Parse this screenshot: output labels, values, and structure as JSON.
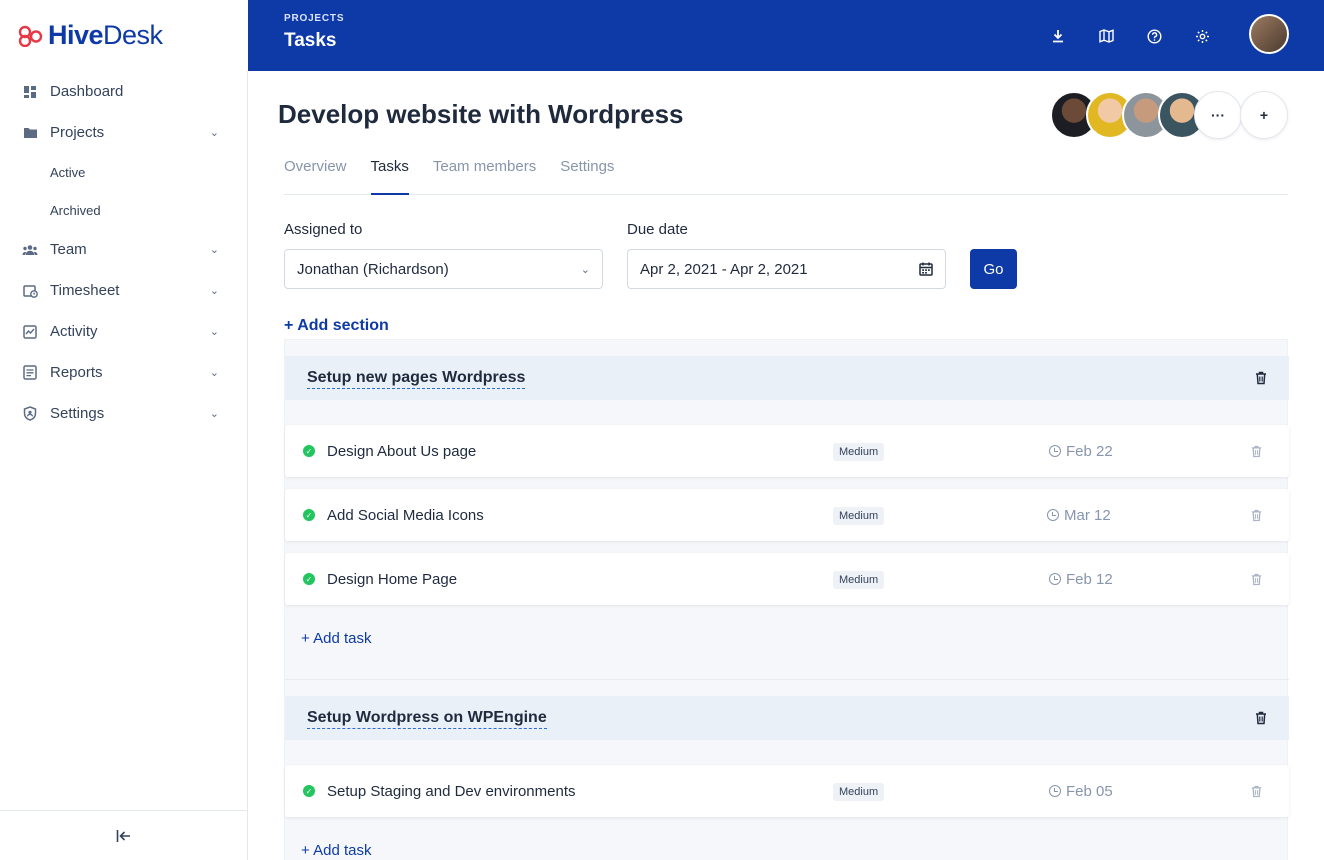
{
  "brand": {
    "name_bold": "Hive",
    "name_light": "Desk"
  },
  "header": {
    "kicker": "PROJECTS",
    "title": "Tasks"
  },
  "sidebar": {
    "items": [
      {
        "label": "Dashboard"
      },
      {
        "label": "Projects"
      },
      {
        "label": "Team"
      },
      {
        "label": "Timesheet"
      },
      {
        "label": "Activity"
      },
      {
        "label": "Reports"
      },
      {
        "label": "Settings"
      }
    ],
    "sub_items": [
      {
        "label": "Active"
      },
      {
        "label": "Archived"
      }
    ]
  },
  "project": {
    "title": "Develop website with Wordpress"
  },
  "members": {
    "more_label": "···",
    "add_label": "+"
  },
  "tabs": [
    {
      "label": "Overview"
    },
    {
      "label": "Tasks"
    },
    {
      "label": "Team members"
    },
    {
      "label": "Settings"
    }
  ],
  "filters": {
    "assigned_label": "Assigned to",
    "assigned_value": "Jonathan (Richardson)",
    "due_label": "Due date",
    "due_value": "Apr 2, 2021 - Apr 2, 2021",
    "go_label": "Go"
  },
  "add_section_label": "+ Add section",
  "sections": [
    {
      "name": "Setup new pages Wordpress",
      "tasks": [
        {
          "name": "Design About Us page",
          "priority": "Medium",
          "due": "Feb 22"
        },
        {
          "name": "Add Social Media Icons",
          "priority": "Medium",
          "due": "Mar 12"
        },
        {
          "name": "Design Home Page",
          "priority": "Medium",
          "due": "Feb 12"
        }
      ],
      "add_task_label": "+ Add task"
    },
    {
      "name": "Setup Wordpress on WPEngine",
      "tasks": [
        {
          "name": "Setup Staging and Dev environments",
          "priority": "Medium",
          "due": "Feb 05"
        }
      ],
      "add_task_label": "+ Add task"
    }
  ],
  "colors": {
    "primary": "#0e3aa8",
    "brand_mark": "#e63946",
    "complete": "#22c55e"
  }
}
